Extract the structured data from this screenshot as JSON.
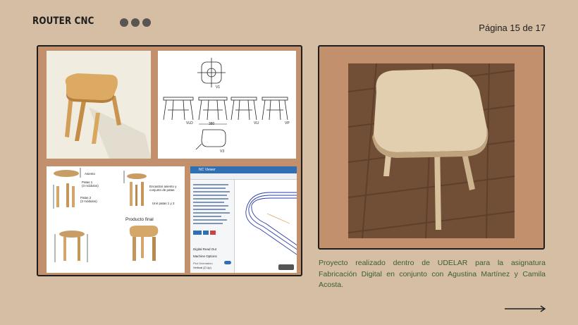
{
  "header": {
    "title": "ROUTER CNC",
    "page_label": "Página 15 de 17"
  },
  "drawing": {
    "label_v1": "V1",
    "label_vld": "VLD",
    "label_vli": "VLI",
    "label_vp": "VP",
    "label_v3": "V3",
    "dim_380": "380"
  },
  "assembly": {
    "label_asiento": "Asiento",
    "label_patas1": "Patas 1\n(3 módulos)",
    "label_patas2": "Patas 2\n(2 módulos)",
    "label_encastrar": "Encastrar asiento y\nconjunto de patas",
    "label_unir": "Unir patas 1 y 2",
    "label_producto_final": "Producto final"
  },
  "ncviewer": {
    "title": "NC Viewer",
    "section_readout": "Digital Read Out",
    "section_machine": "Machine Options",
    "plot_orientation": "Plot Orientation",
    "plot_orientation_value": "Vertical (Z-Up)"
  },
  "caption": "Proyecto realizado dentro de UDELAR para la asignatura Fabricación Digital en conjunto con Agustina Martínez y Camila Acosta.",
  "colors": {
    "background": "#d5bea3",
    "panel": "#c2906d",
    "caption_text": "#3a5e34"
  }
}
